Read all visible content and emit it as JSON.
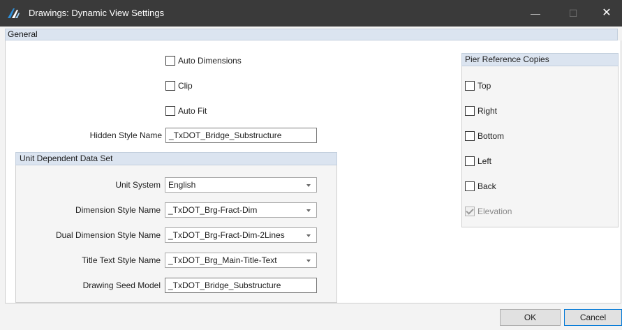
{
  "window": {
    "title": "Drawings: Dynamic View Settings",
    "minimize_glyph": "—",
    "maximize_glyph": "☐",
    "close_glyph": "✕",
    "app_icon": "openbridge-logo-icon"
  },
  "general": {
    "header": "General",
    "auto_dimensions": {
      "label": "Auto Dimensions",
      "checked": false
    },
    "clip": {
      "label": "Clip",
      "checked": false
    },
    "auto_fit": {
      "label": "Auto Fit",
      "checked": false
    },
    "hidden_style_name": {
      "label": "Hidden Style Name",
      "value": "_TxDOT_Bridge_Substructure"
    }
  },
  "unit_dependent": {
    "header": "Unit Dependent Data Set",
    "unit_system": {
      "label": "Unit System",
      "value": "English"
    },
    "dimension_style_name": {
      "label": "Dimension Style Name",
      "value": "_TxDOT_Brg-Fract-Dim"
    },
    "dual_dimension_style_name": {
      "label": "Dual Dimension Style Name",
      "value": "_TxDOT_Brg-Fract-Dim-2Lines"
    },
    "title_text_style_name": {
      "label": "Title Text Style Name",
      "value": "_TxDOT_Brg_Main-Title-Text"
    },
    "drawing_seed_model": {
      "label": "Drawing Seed Model",
      "value": "_TxDOT_Bridge_Substructure"
    }
  },
  "pier_reference_copies": {
    "header": "Pier Reference Copies",
    "top": {
      "label": "Top",
      "checked": false
    },
    "right": {
      "label": "Right",
      "checked": false
    },
    "bottom": {
      "label": "Bottom",
      "checked": false
    },
    "left": {
      "label": "Left",
      "checked": false
    },
    "back": {
      "label": "Back",
      "checked": false
    },
    "elevation": {
      "label": "Elevation",
      "checked": true,
      "enabled": false
    }
  },
  "buttons": {
    "ok": "OK",
    "cancel": "Cancel"
  },
  "colors": {
    "titlebar": "#3a3a3a",
    "section_header": "#dbe4f0",
    "focus_border": "#0078d7"
  }
}
